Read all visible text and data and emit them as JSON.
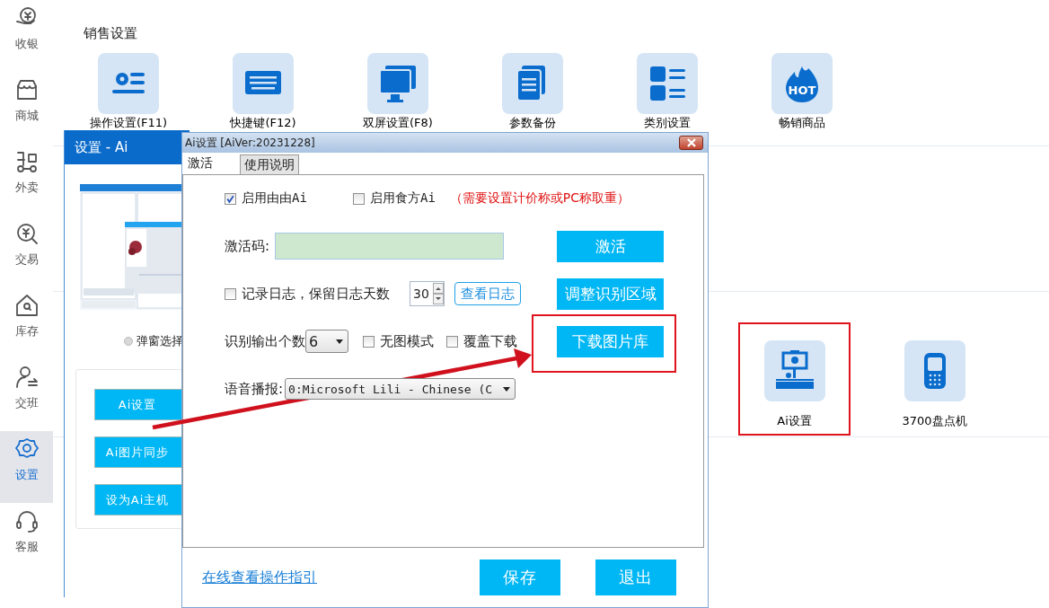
{
  "sidebar": {
    "items": [
      {
        "label": "收银",
        "selected": false
      },
      {
        "label": "商城",
        "selected": false
      },
      {
        "label": "外卖",
        "selected": false
      },
      {
        "label": "交易",
        "selected": false
      },
      {
        "label": "库存",
        "selected": false
      },
      {
        "label": "交班",
        "selected": false
      },
      {
        "label": "设置",
        "selected": true
      },
      {
        "label": "客服",
        "selected": false
      }
    ]
  },
  "sales_section": {
    "title": "销售设置",
    "items": [
      {
        "label": "操作设置(F11)"
      },
      {
        "label": "快捷键(F12)"
      },
      {
        "label": "双屏设置(F8)"
      },
      {
        "label": "参数备份"
      },
      {
        "label": "类别设置"
      },
      {
        "label": "畅销商品",
        "icon_text": "HOT"
      }
    ]
  },
  "tools_section": {
    "items": [
      {
        "label": "Ai设置",
        "highlighted": true
      },
      {
        "label": "3700盘点机",
        "highlighted": false
      }
    ]
  },
  "ai_panel": {
    "title": "设置 - Ai",
    "radio": {
      "label": "弹窗选择",
      "selected": false
    },
    "buttons": [
      "Ai设置",
      "Ai图片同步",
      "设为Ai主机"
    ]
  },
  "dialog": {
    "title": "Ai设置 [AiVer:20231228]",
    "tabs": [
      {
        "label": "激活",
        "selected": true
      },
      {
        "label": "使用说明",
        "selected": false
      }
    ],
    "engines": [
      {
        "label": "启用由由Ai",
        "checked": true
      },
      {
        "label": "启用食方Ai",
        "checked": false
      }
    ],
    "note": "（需要设置计价称或PC称取重）",
    "activation": {
      "label": "激活码:"
    },
    "log": {
      "label": "记录日志，保留日志天数",
      "checked": false,
      "days": "30",
      "view_button": "查看日志"
    },
    "output": {
      "label": "识别输出个数",
      "count": "6",
      "options": [
        {
          "label": "无图模式",
          "checked": false
        },
        {
          "label": "覆盖下载",
          "checked": false
        }
      ]
    },
    "voice": {
      "label": "语音播报:",
      "value": "0:Microsoft Lili - Chinese (C"
    },
    "side_buttons": [
      {
        "label": "激活",
        "highlighted": false
      },
      {
        "label": "调整识别区域",
        "highlighted": false
      },
      {
        "label": "下载图片库",
        "highlighted": true
      }
    ],
    "guide_link": "在线查看操作指引",
    "buttons": [
      "保存",
      "退出"
    ]
  }
}
